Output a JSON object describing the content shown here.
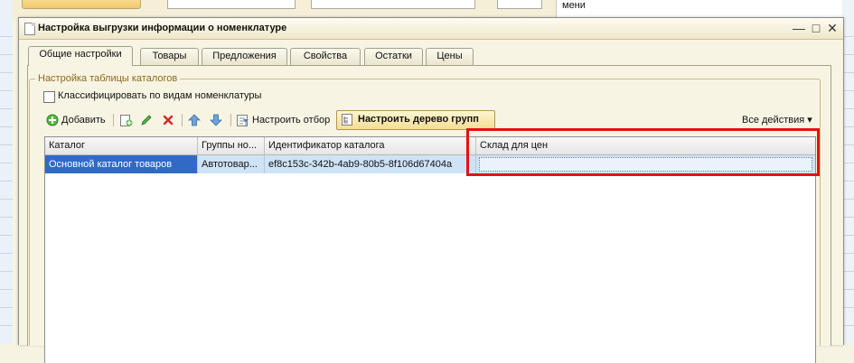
{
  "background": {
    "right_panel_label": "мени"
  },
  "dialog": {
    "title": "Настройка выгрузки информации о номенклатуре",
    "window_controls": {
      "minimize": "—",
      "maximize": "□",
      "close": "✕"
    },
    "tabs": [
      {
        "label": "Общие настройки",
        "active": true
      },
      {
        "label": "Товары",
        "active": false
      },
      {
        "label": "Предложения",
        "active": false
      },
      {
        "label": "Свойства",
        "active": false
      },
      {
        "label": "Остатки",
        "active": false
      },
      {
        "label": "Цены",
        "active": false
      }
    ],
    "group": {
      "title": "Настройка таблицы каталогов",
      "checkbox": {
        "label": "Классифицировать по видам номенклатуры",
        "checked": false
      }
    },
    "toolbar": {
      "add_label": "Добавить",
      "filter_label": "Настроить отбор",
      "tree_label": "Настроить дерево групп",
      "all_actions_label": "Все действия ▾",
      "icons": [
        "add-icon",
        "copy-icon",
        "edit-icon",
        "delete-icon",
        "move-up-icon",
        "move-down-icon",
        "filter-icon",
        "tree-icon"
      ]
    },
    "table": {
      "columns": [
        "Каталог",
        "Группы но...",
        "Идентификатор каталога",
        "Склад для цен"
      ],
      "rows": [
        [
          "Основной каталог товаров",
          "Автотовар...",
          "ef8c153c-342b-4ab9-80b5-8f106d67404a",
          ""
        ]
      ]
    },
    "highlight_color": "#e21313"
  }
}
